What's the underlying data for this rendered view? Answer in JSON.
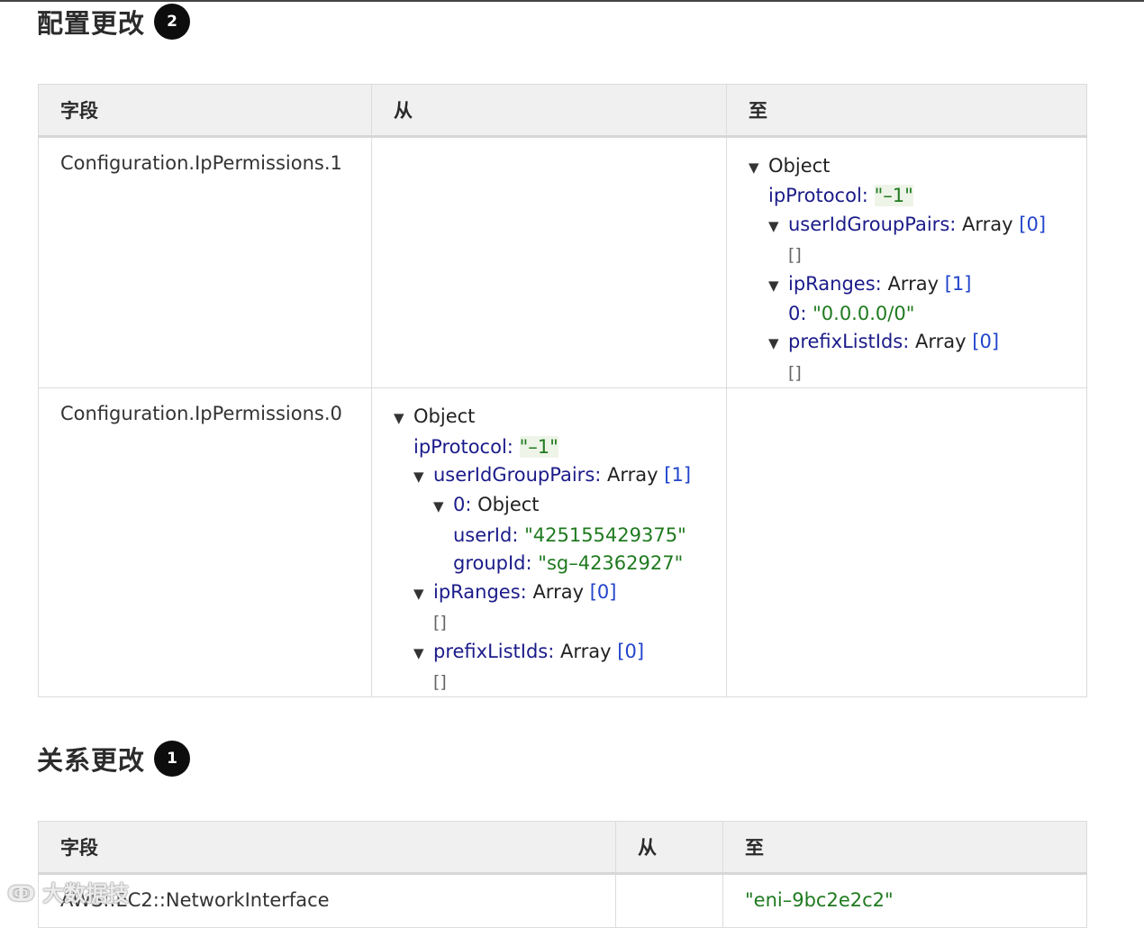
{
  "sections": {
    "config": {
      "title": "配置更改",
      "badge": "2",
      "headers": {
        "field": "字段",
        "from": "从",
        "to": "至"
      },
      "rows": [
        {
          "field": "Configuration.IpPermissions.1",
          "to": {
            "object": "Object",
            "ipProtocol_key": "ipProtocol:",
            "ipProtocol_val": "\"–1\"",
            "userIdGroupPairs_key": "userIdGroupPairs:",
            "userIdGroupPairs_type": "Array",
            "userIdGroupPairs_count": "[0]",
            "userIdGroupPairs_empty": "[]",
            "ipRanges_key": "ipRanges:",
            "ipRanges_type": "Array",
            "ipRanges_count": "[1]",
            "ipRanges_0_key": "0:",
            "ipRanges_0_val": "\"0.0.0.0/0\"",
            "prefixListIds_key": "prefixListIds:",
            "prefixListIds_type": "Array",
            "prefixListIds_count": "[0]",
            "prefixListIds_empty": "[]"
          }
        },
        {
          "field": "Configuration.IpPermissions.0",
          "from": {
            "object": "Object",
            "ipProtocol_key": "ipProtocol:",
            "ipProtocol_val": "\"–1\"",
            "userIdGroupPairs_key": "userIdGroupPairs:",
            "userIdGroupPairs_type": "Array",
            "userIdGroupPairs_count": "[1]",
            "item0_key": "0:",
            "item0_type": "Object",
            "userId_key": "userId:",
            "userId_val": "\"425155429375\"",
            "groupId_key": "groupId:",
            "groupId_val": "\"sg–42362927\"",
            "ipRanges_key": "ipRanges:",
            "ipRanges_type": "Array",
            "ipRanges_count": "[0]",
            "ipRanges_empty": "[]",
            "prefixListIds_key": "prefixListIds:",
            "prefixListIds_type": "Array",
            "prefixListIds_count": "[0]",
            "prefixListIds_empty": "[]"
          }
        }
      ]
    },
    "relations": {
      "title": "关系更改",
      "badge": "1",
      "headers": {
        "field": "字段",
        "from": "从",
        "to": "至"
      },
      "rows": [
        {
          "field": "AWS::EC2::NetworkInterface",
          "from": "",
          "to": "\"eni–9bc2e2c2\""
        }
      ]
    }
  },
  "watermark": "大数据技"
}
